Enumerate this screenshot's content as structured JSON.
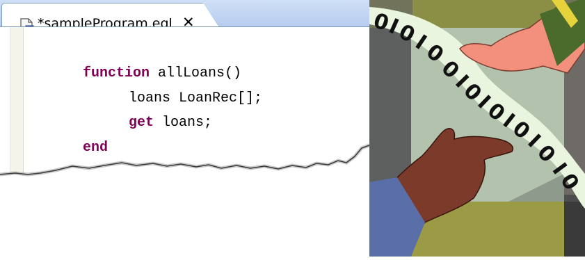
{
  "editor": {
    "tab_title": "*sampleProgram.egl",
    "tab_close_glyph": "✕",
    "file_icon": "egl-file-icon",
    "code": {
      "line1_kw": "function",
      "line1_rest": " allLoans()",
      "line2": "loans LoanRec[];",
      "line3_kw": "get",
      "line3_rest": " loans;",
      "line4_kw": "end"
    },
    "colors": {
      "keyword": "#7f0055",
      "tab_bar": "#c4d7f1"
    }
  },
  "illustration": {
    "name": "hands-passing-binary-data-clipart",
    "colors": {
      "background_dark": "#5a5a5a",
      "olive": "#8a8d3a",
      "upper_hand": "#f08a7a",
      "lower_hand": "#7a3a2a",
      "ribbon": "#e8f5e0"
    }
  }
}
